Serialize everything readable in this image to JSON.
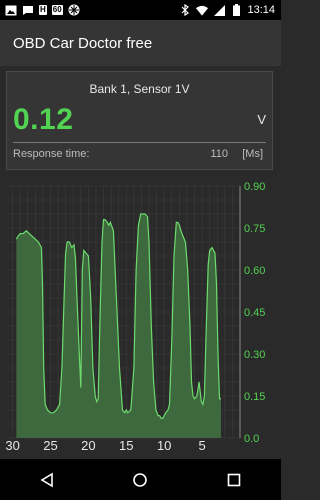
{
  "status_bar": {
    "time": "13:14",
    "left_icons": [
      "image-icon",
      "chat-icon",
      "h-box-icon",
      "60-box-icon",
      "grid-app-icon"
    ],
    "h_box": "H",
    "sixty_box": "60",
    "right_icons": [
      "bluetooth-icon",
      "wifi-icon",
      "signal-icon",
      "battery-icon"
    ]
  },
  "app_bar": {
    "title": "OBD Car Doctor free"
  },
  "sensor": {
    "name": "Bank 1, Sensor 1V",
    "value": "0.12",
    "unit": "V",
    "response_label": "Response time:",
    "response_value": "110",
    "response_unit": "[Ms]"
  },
  "colors": {
    "accent": "#52d352",
    "line": "#6ddc6d",
    "fill": "#3f6b3f",
    "background": "#2a2a2a",
    "grid": "#3c3c3c"
  },
  "chart_data": {
    "type": "area",
    "title": "",
    "xlabel": "",
    "ylabel": "",
    "x_ticks": [
      "30",
      "25",
      "20",
      "15",
      "10",
      "5"
    ],
    "y_ticks": [
      "0.90",
      "0.75",
      "0.60",
      "0.45",
      "0.30",
      "0.15",
      "0.0"
    ],
    "xlim": [
      31,
      0
    ],
    "ylim": [
      0,
      0.9
    ],
    "grid": true,
    "series": [
      {
        "x": [
          29.5,
          29.3,
          29.0,
          28.6,
          28.2,
          27.8,
          27.4,
          27.0,
          26.6,
          26.2,
          26.05,
          25.9,
          25.7,
          25.4,
          25.0,
          24.6,
          24.2,
          23.8,
          23.5,
          23.2,
          23.0,
          22.8,
          22.5,
          22.2,
          21.9,
          21.7,
          21.5,
          21.2,
          21.0,
          20.8,
          20.6,
          20.3,
          20.0,
          19.7,
          19.4,
          19.1,
          18.9,
          18.7,
          18.5,
          18.2,
          18.0,
          17.8,
          17.5,
          17.3,
          17.1,
          16.7,
          16.3,
          15.9,
          15.5,
          15.2,
          15.0,
          14.8,
          14.4,
          14.0,
          13.7,
          13.4,
          13.1,
          12.9,
          12.7,
          12.5,
          12.2,
          12.0,
          11.7,
          11.4,
          11.1,
          10.8,
          10.6,
          10.4,
          10.2,
          10.0,
          9.8,
          9.5,
          9.3,
          9.0,
          8.7,
          8.4,
          8.2,
          8.0,
          7.8,
          7.5,
          7.2,
          6.9,
          6.6,
          6.4,
          6.2,
          6.0,
          5.7,
          5.4,
          5.1,
          4.9,
          4.7,
          4.5,
          4.2,
          4.0,
          3.7,
          3.5,
          3.3,
          3.1,
          2.9,
          2.7,
          2.5
        ],
        "y": [
          0.71,
          0.72,
          0.73,
          0.73,
          0.74,
          0.73,
          0.72,
          0.71,
          0.7,
          0.68,
          0.55,
          0.25,
          0.12,
          0.1,
          0.09,
          0.09,
          0.1,
          0.12,
          0.25,
          0.5,
          0.66,
          0.7,
          0.7,
          0.68,
          0.69,
          0.64,
          0.5,
          0.3,
          0.18,
          0.6,
          0.67,
          0.66,
          0.65,
          0.5,
          0.25,
          0.15,
          0.13,
          0.14,
          0.4,
          0.7,
          0.78,
          0.78,
          0.77,
          0.76,
          0.77,
          0.74,
          0.5,
          0.25,
          0.1,
          0.09,
          0.1,
          0.09,
          0.1,
          0.25,
          0.6,
          0.76,
          0.8,
          0.8,
          0.8,
          0.8,
          0.79,
          0.7,
          0.4,
          0.2,
          0.1,
          0.08,
          0.08,
          0.07,
          0.07,
          0.08,
          0.09,
          0.1,
          0.12,
          0.35,
          0.65,
          0.77,
          0.77,
          0.76,
          0.74,
          0.72,
          0.7,
          0.6,
          0.4,
          0.2,
          0.15,
          0.14,
          0.15,
          0.2,
          0.13,
          0.12,
          0.15,
          0.35,
          0.62,
          0.67,
          0.68,
          0.67,
          0.66,
          0.55,
          0.3,
          0.14,
          0.14
        ]
      }
    ]
  },
  "nav_bar": {
    "buttons": [
      "back-icon",
      "home-icon",
      "recents-icon"
    ]
  }
}
